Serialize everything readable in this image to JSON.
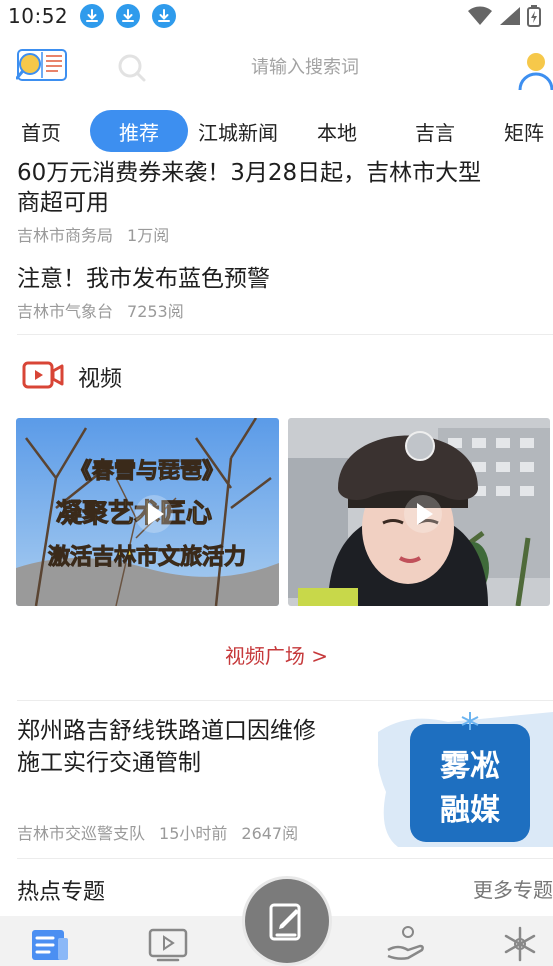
{
  "status_bar": {
    "time": "10:52",
    "download_count": 3
  },
  "header": {
    "logo_text": "看报",
    "search_placeholder": "请输入搜索词"
  },
  "tabs": [
    {
      "label": "首页",
      "active": false
    },
    {
      "label": "推荐",
      "active": true
    },
    {
      "label": "江城新闻",
      "active": false
    },
    {
      "label": "本地",
      "active": false
    },
    {
      "label": "吉言",
      "active": false
    },
    {
      "label": "矩阵",
      "active": false
    }
  ],
  "news": [
    {
      "title_line1": "60万元消费券来袭！3月28日起，吉林市大型",
      "title_line2": "商超可用",
      "source": "吉林市商务局",
      "reads": "1万阅"
    },
    {
      "title": "注意！我市发布蓝色预警",
      "source": "吉林市气象台",
      "reads": "7253阅"
    }
  ],
  "video_section": {
    "label": "视频",
    "thumb1_caption_line1": "《春雪与琵琶》",
    "thumb1_caption_line2": "凝聚艺术匠心",
    "thumb1_caption_line3": "激活吉林市文旅活力",
    "more_link": "视频广场 >"
  },
  "news3": {
    "title_line1": "郑州路吉舒线铁路道口因维修",
    "title_line2": "施工实行交通管制",
    "source": "吉林市交巡警支队",
    "time": "15小时前",
    "reads": "2647阅",
    "image_text_line1": "雾凇",
    "image_text_line2": "融媒"
  },
  "hot_topics": {
    "title": "热点专题",
    "more": "更多专题"
  },
  "colors": {
    "accent": "#3d8ff0",
    "video_red": "#c6393b",
    "download_blue": "#2f9bec"
  }
}
